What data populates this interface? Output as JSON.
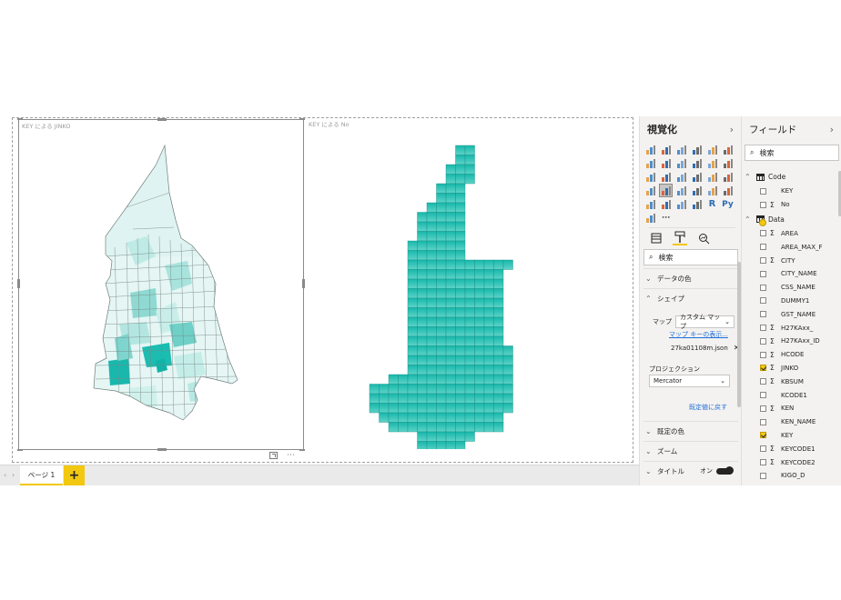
{
  "canvas": {
    "visual1_title": "KEY による JINKO",
    "visual2_title": "KEY による No",
    "more_options": "⋯"
  },
  "page_tabs": {
    "items": [
      "ページ 1"
    ],
    "add_label": "+"
  },
  "visualizations": {
    "title": "視覚化",
    "expand": "›",
    "more": "⋯",
    "search_placeholder": "検索",
    "sections": {
      "data_colors": "データの色",
      "shape": "シェイプ",
      "default_color": "既定の色",
      "zoom": "ズーム",
      "title": "タイトル"
    },
    "shape": {
      "map_label": "マップ",
      "map_value": "カスタム マップ",
      "map_keys_link": "マップ キーの表示...",
      "file_name": "27ka01108m.json",
      "projection_label": "プロジェクション",
      "projection_value": "Mercator",
      "reset_label": "既定値に戻す"
    },
    "title_toggle_label": "オン"
  },
  "fields": {
    "title": "フィールド",
    "expand": "›",
    "search_placeholder": "検索",
    "tables": [
      {
        "name": "Code",
        "checked": false,
        "fields": [
          {
            "name": "KEY",
            "sigma": false,
            "checked": false
          },
          {
            "name": "No",
            "sigma": true,
            "checked": false
          }
        ]
      },
      {
        "name": "Data",
        "checked": true,
        "fields": [
          {
            "name": "AREA",
            "sigma": true,
            "checked": false
          },
          {
            "name": "AREA_MAX_F",
            "sigma": false,
            "checked": false
          },
          {
            "name": "CITY",
            "sigma": true,
            "checked": false
          },
          {
            "name": "CITY_NAME",
            "sigma": false,
            "checked": false
          },
          {
            "name": "CSS_NAME",
            "sigma": false,
            "checked": false
          },
          {
            "name": "DUMMY1",
            "sigma": false,
            "checked": false
          },
          {
            "name": "GST_NAME",
            "sigma": false,
            "checked": false
          },
          {
            "name": "H27KAxx_",
            "sigma": true,
            "checked": false
          },
          {
            "name": "H27KAxx_ID",
            "sigma": true,
            "checked": false
          },
          {
            "name": "HCODE",
            "sigma": true,
            "checked": false
          },
          {
            "name": "JINKO",
            "sigma": true,
            "checked": true
          },
          {
            "name": "KBSUM",
            "sigma": true,
            "checked": false
          },
          {
            "name": "KCODE1",
            "sigma": false,
            "checked": false
          },
          {
            "name": "KEN",
            "sigma": true,
            "checked": false
          },
          {
            "name": "KEN_NAME",
            "sigma": false,
            "checked": false
          },
          {
            "name": "KEY",
            "sigma": false,
            "checked": true
          },
          {
            "name": "KEYCODE1",
            "sigma": true,
            "checked": false
          },
          {
            "name": "KEYCODE2",
            "sigma": true,
            "checked": false
          },
          {
            "name": "KIGO_D",
            "sigma": false,
            "checked": false
          }
        ]
      }
    ]
  },
  "colors": {
    "accent": "#f2c811",
    "map_light": "#d6f2ef",
    "map_dark": "#19b8ad",
    "grid_top": "#16b8ab",
    "grid_bottom": "#5fd3c8"
  }
}
